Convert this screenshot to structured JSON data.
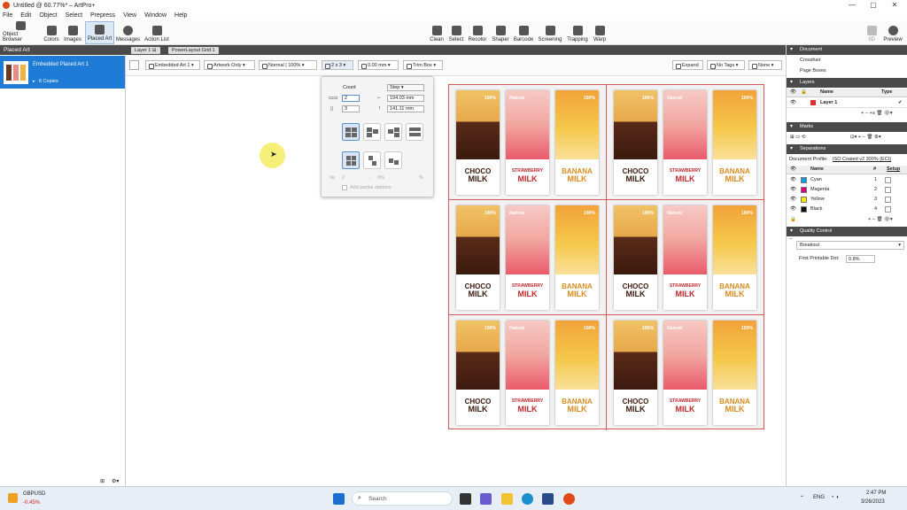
{
  "window": {
    "title": "Untitled @ 60.77%* – ArtPro+"
  },
  "menu": [
    "File",
    "Edit",
    "Object",
    "Select",
    "Prepress",
    "View",
    "Window",
    "Help"
  ],
  "toolbar": {
    "left": [
      "Object Browser",
      "Colors",
      "Images",
      "Placed Art",
      "Messages",
      "Action List"
    ],
    "center": [
      "Clean",
      "Select",
      "Recolor",
      "Shaper",
      "Barcode",
      "Screening",
      "Trapping",
      "Warp"
    ],
    "right": [
      "3D",
      "Preview"
    ],
    "active": "Placed Art"
  },
  "left_panel": {
    "title": "Placed Art",
    "item_name": "Embedded Placed Art 1",
    "item_sub": "6 Copies"
  },
  "doc_tabs": [
    "Layer 1",
    "PowerLayout Grid 1"
  ],
  "options": {
    "placed_art": "Embedded Art 1",
    "artwork": "Artwork Only",
    "blend": "Normal | 100%",
    "grid": "2 x 3",
    "offset": "0.00 mm",
    "box": "Trim Box",
    "expand": "Expand",
    "tags": "No Tags",
    "none": "None"
  },
  "grid_popover": {
    "count_label": "Count",
    "step_label": "Step",
    "cols": "2",
    "rows": "3",
    "width": "194.03 mm",
    "height": "141.11 mm",
    "n_label": "2",
    "pct_label": "0%",
    "pct_sign": "%",
    "partial_label": "Add partial stations"
  },
  "products": [
    {
      "badge": "100%",
      "line1": "CHOCO",
      "line2": "MILK",
      "color": "#3b1a0e"
    },
    {
      "badge": "Natural",
      "line1": "STRAWBERRY",
      "line2": "MILK",
      "color": "#c0272d"
    },
    {
      "badge": "100%",
      "line1": "BANANA",
      "line2": "MILK",
      "color": "#d88a1e"
    }
  ],
  "right_panel": {
    "document": {
      "title": "Document",
      "items": [
        "Crosshair",
        "Page Boxes"
      ]
    },
    "layers": {
      "title": "Layers",
      "col_name": "Name",
      "col_type": "Type",
      "layer": "Layer 1"
    },
    "marks": {
      "title": "Marks"
    },
    "separations": {
      "title": "Separations",
      "profile_label": "Document Profile:",
      "profile_value": "ISO Coated v2 300% (ECI)",
      "col_name": "Name",
      "col_num": "#",
      "col_setup": "Setup",
      "inks": [
        {
          "name": "Cyan",
          "num": "1",
          "color": "#00a0e0"
        },
        {
          "name": "Magenta",
          "num": "2",
          "color": "#e0007a"
        },
        {
          "name": "Yellow",
          "num": "3",
          "color": "#ffe800"
        },
        {
          "name": "Black",
          "num": "4",
          "color": "#111111"
        }
      ]
    },
    "quality": {
      "title": "Quality Control",
      "mode": "Breakout",
      "fpd_label": "First Printable Dot:",
      "fpd_value": "0.8%"
    }
  },
  "taskbar": {
    "ticker": "GBPUSD",
    "change": "-0.45%",
    "search": "Search",
    "lang": "ENG",
    "time": "2:47 PM",
    "date": "3/26/2023"
  }
}
